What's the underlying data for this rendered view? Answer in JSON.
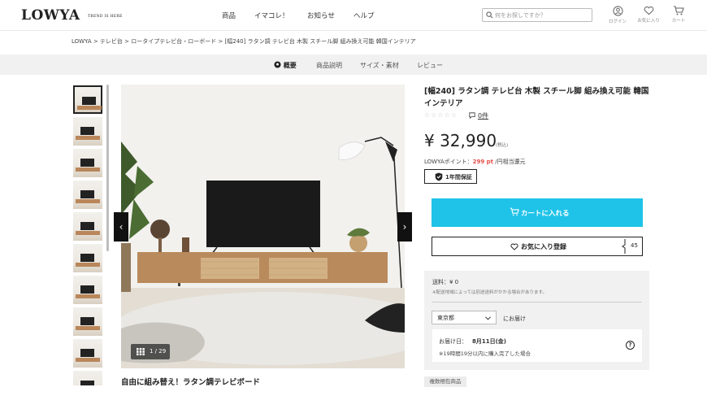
{
  "header": {
    "logo": "LOWYA",
    "tagline": "TREND IS HERE",
    "nav": [
      "商品",
      "イマコレ！",
      "お知らせ",
      "ヘルプ"
    ],
    "search_placeholder": "何をお探しですか？",
    "icons": [
      {
        "label": "ログイン",
        "icon": "user-icon"
      },
      {
        "label": "お気に入り",
        "icon": "heart-icon"
      },
      {
        "label": "カート",
        "icon": "cart-icon"
      }
    ]
  },
  "breadcrumb": "LOWYA > テレビ台 > ロータイプテレビ台・ローボード > [幅240] ラタン調 テレビ台 木製 スチール脚 組み換え可能 韓国インテリア",
  "tabs": [
    "概要",
    "商品説明",
    "サイズ・素材",
    "レビュー"
  ],
  "gallery": {
    "counter": "1 / 29",
    "caption": "自由に組み替え！ラタン調テレビボード",
    "prev": "‹",
    "next": "›"
  },
  "product": {
    "title": "[幅240] ラタン調 テレビ台 木製 スチール脚 組み換え可能 韓国インテリア",
    "stars": "☆☆☆☆☆",
    "review_count": "0件",
    "price": "¥ 32,990",
    "tax_label": "(税込)",
    "points_label": "LOWYAポイント：",
    "points_value": "299 pt",
    "points_suffix": " /円相当還元",
    "warranty": "1年間保証",
    "cart_button": "カートに入れる",
    "favorite_button": "お気に入り登録",
    "favorite_count": "45"
  },
  "shipping": {
    "fee": "送料：¥ 0",
    "note": "※配送地域によっては別途送料がかかる場合があります。",
    "prefecture": "東京都",
    "deliver_label": "にお届け",
    "date_label": "お届け日：",
    "date_value": "8月11日(金)",
    "date_note": "※19時間19分以内に購入完了した場合",
    "help": "?"
  },
  "badge": "複数梱包商品",
  "colors": {
    "accent": "#1fc3e8",
    "points": "#e2504a"
  }
}
